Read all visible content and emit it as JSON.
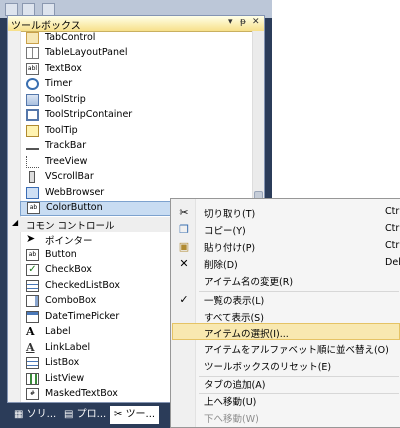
{
  "toolbox": {
    "title": "ツールボックス",
    "pin": "ᵽ",
    "close": "✕",
    "dropdown": "▾",
    "items": [
      {
        "label": "TabControl",
        "icon": "tab-control-icon"
      },
      {
        "label": "TableLayoutPanel",
        "icon": "table-layout-panel-icon"
      },
      {
        "label": "TextBox",
        "icon": "text-box-icon"
      },
      {
        "label": "Timer",
        "icon": "timer-icon"
      },
      {
        "label": "ToolStrip",
        "icon": "tool-strip-icon"
      },
      {
        "label": "ToolStripContainer",
        "icon": "tool-strip-container-icon"
      },
      {
        "label": "ToolTip",
        "icon": "tooltip-icon"
      },
      {
        "label": "TrackBar",
        "icon": "track-bar-icon"
      },
      {
        "label": "TreeView",
        "icon": "tree-view-icon"
      },
      {
        "label": "VScrollBar",
        "icon": "vscrollbar-icon"
      },
      {
        "label": "WebBrowser",
        "icon": "web-browser-icon"
      },
      {
        "label": "ColorButton",
        "icon": "color-button-icon"
      }
    ],
    "category": "コモン コントロール",
    "common": [
      {
        "label": "ポインター",
        "icon": "pointer-icon"
      },
      {
        "label": "Button",
        "icon": "button-icon"
      },
      {
        "label": "CheckBox",
        "icon": "checkbox-icon"
      },
      {
        "label": "CheckedListBox",
        "icon": "checked-list-box-icon"
      },
      {
        "label": "ComboBox",
        "icon": "combo-box-icon"
      },
      {
        "label": "DateTimePicker",
        "icon": "date-time-picker-icon"
      },
      {
        "label": "Label",
        "icon": "label-icon"
      },
      {
        "label": "LinkLabel",
        "icon": "link-label-icon"
      },
      {
        "label": "ListBox",
        "icon": "list-box-icon"
      },
      {
        "label": "ListView",
        "icon": "list-view-icon"
      },
      {
        "label": "MaskedTextBox",
        "icon": "masked-text-box-icon"
      }
    ]
  },
  "tabs": [
    {
      "label": "ソリ..."
    },
    {
      "label": "プロ..."
    },
    {
      "label": "ツー..."
    }
  ],
  "menu": {
    "cut": "切り取り(T)",
    "cut_sc": "Ctrl+",
    "copy": "コピー(Y)",
    "copy_sc": "Ctrl+",
    "paste": "貼り付け(P)",
    "paste_sc": "Ctrl+",
    "delete": "削除(D)",
    "delete_sc": "Del",
    "rename": "アイテム名の変更(R)",
    "listview": "一覧の表示(L)",
    "showall": "すべて表示(S)",
    "choose": "アイテムの選択(I)...",
    "sort": "アイテムをアルファベット順に並べ替え(O)",
    "reset": "ツールボックスのリセット(E)",
    "addtab": "タブの追加(A)",
    "moveup": "上へ移動(U)",
    "movedown": "下へ移動(W)"
  }
}
